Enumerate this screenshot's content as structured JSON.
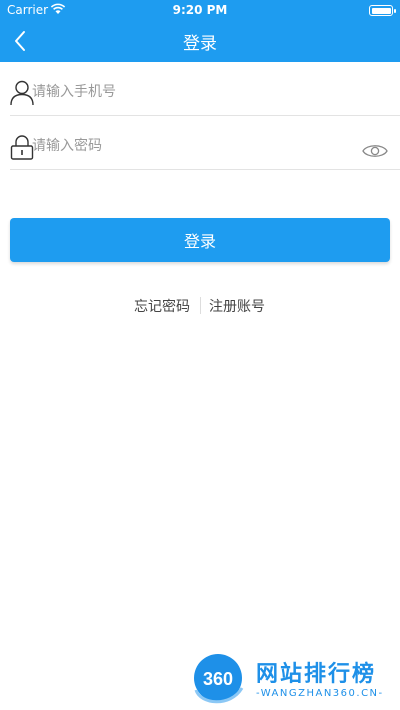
{
  "status_bar": {
    "carrier": "Carrier",
    "time": "9:20 PM"
  },
  "nav": {
    "title": "登录",
    "back_icon": "chevron-left-icon"
  },
  "form": {
    "phone_placeholder": "请输入手机号",
    "phone_value": "",
    "password_placeholder": "请输入密码",
    "password_value": "",
    "login_label": "登录"
  },
  "links": {
    "forgot_password": "忘记密码",
    "register": "注册账号"
  },
  "watermark": {
    "logo_text": "360",
    "name": "网站排行榜",
    "url": "-WANGZHAN360.CN-"
  },
  "colors": {
    "primary": "#1e9cf0",
    "placeholder": "#999999",
    "divider": "#e3e3e3"
  }
}
